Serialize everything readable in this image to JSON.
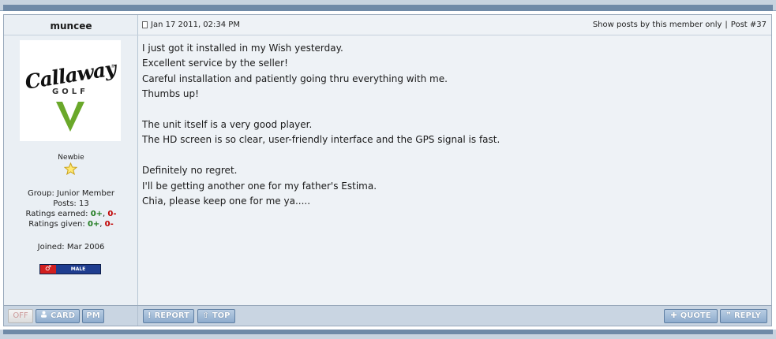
{
  "user": {
    "name": "muncee",
    "avatar_logo": "Callaway",
    "avatar_logo_sub": "GOLF",
    "rank": "Newbie",
    "group": "Group: Junior Member",
    "posts": "Posts: 13",
    "ratings_earned_label": "Ratings earned: ",
    "ratings_earned_pos": "0+",
    "ratings_earned_neg": "0-",
    "ratings_given_label": "Ratings given: ",
    "ratings_given_pos": "0+",
    "ratings_given_neg": "0-",
    "joined": "Joined: Mar 2006",
    "gender_badge": "MALE",
    "gender_symbol": "♂"
  },
  "post": {
    "date": "Jan 17 2011, 02:34 PM",
    "show_posts_link": "Show posts by this member only",
    "separator": "|",
    "post_number": "Post #37",
    "body_lines": [
      "I just got it installed in my Wish yesterday.",
      "Excellent service by the seller!",
      "Careful installation and patiently going thru everything with me.",
      "Thumbs up!",
      "",
      "The unit itself is a very good player.",
      "The HD screen is so clear, user-friendly interface and the GPS signal is fast.",
      "",
      "Definitely no regret.",
      "I'll be getting another one for my father's Estima.",
      "Chia, please keep one for me ya....."
    ]
  },
  "footer": {
    "off_label": "OFF",
    "card_label": "CARD",
    "pm_label": "PM",
    "report_label": "REPORT",
    "top_label": "TOP",
    "quote_label": "QUOTE",
    "reply_label": "REPLY"
  },
  "icons": {
    "post": "document-icon",
    "card": "user-icon",
    "report": "exclamation-icon",
    "top": "arrow-up-icon",
    "quote": "plus-icon",
    "reply": "quote-marks-icon",
    "rank": "star-icon"
  },
  "colors": {
    "positive": "#1e7a1e",
    "negative": "#c00000",
    "button": "#8eaccd",
    "avatar_check": "#6aa82a"
  }
}
